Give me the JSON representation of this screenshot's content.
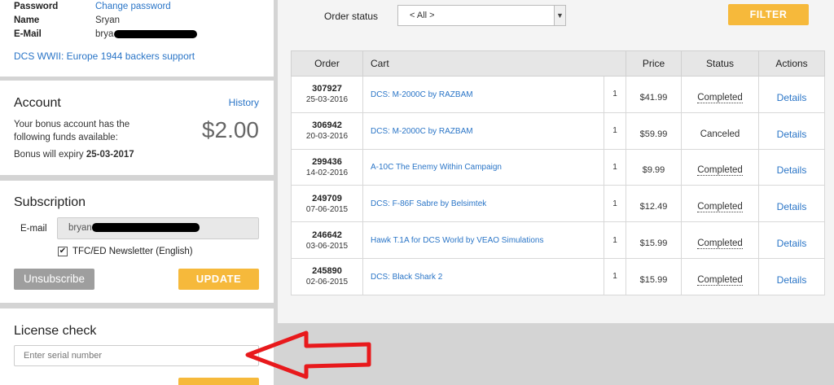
{
  "profile": {
    "password_label": "Password",
    "password_link": "Change password",
    "name_label": "Name",
    "name_value": "Sryan",
    "email_label": "E-Mail",
    "email_value": "brya",
    "backers_link": "DCS WWII: Europe 1944 backers support"
  },
  "account": {
    "title": "Account",
    "history_link": "History",
    "description": "Your bonus account has the following funds available:",
    "amount": "$2.00",
    "expiry_label": "Bonus will expiry",
    "expiry_date": "25-03-2017"
  },
  "subscription": {
    "title": "Subscription",
    "email_label": "E-mail",
    "email_value": "bryan",
    "newsletter_label": "TFC/ED Newsletter (English)",
    "newsletter_checked": true,
    "unsubscribe_label": "Unsubscribe",
    "update_label": "UPDATE"
  },
  "license": {
    "title": "License check",
    "serial_placeholder": "Enter serial number"
  },
  "filter": {
    "order_status_label": "Order status",
    "select_value": "< All >",
    "filter_button": "FILTER"
  },
  "table": {
    "headers": [
      "Order",
      "Cart",
      "Price",
      "Status",
      "Actions"
    ],
    "rows": [
      {
        "order": "307927",
        "date": "25-03-2016",
        "cart": "DCS: M-2000C by RAZBAM",
        "qty": "1",
        "price": "$41.99",
        "status": "Completed",
        "action": "Details"
      },
      {
        "order": "306942",
        "date": "20-03-2016",
        "cart": "DCS: M-2000C by RAZBAM",
        "qty": "1",
        "price": "$59.99",
        "status": "Canceled",
        "action": "Details"
      },
      {
        "order": "299436",
        "date": "14-02-2016",
        "cart": "A-10C The Enemy Within Campaign",
        "qty": "1",
        "price": "$9.99",
        "status": "Completed",
        "action": "Details"
      },
      {
        "order": "249709",
        "date": "07-06-2015",
        "cart": "DCS: F-86F Sabre by Belsimtek",
        "qty": "1",
        "price": "$12.49",
        "status": "Completed",
        "action": "Details"
      },
      {
        "order": "246642",
        "date": "03-06-2015",
        "cart": "Hawk T.1A for DCS World by VEAO Simulations",
        "qty": "1",
        "price": "$15.99",
        "status": "Completed",
        "action": "Details"
      },
      {
        "order": "245890",
        "date": "02-06-2015",
        "cart": "DCS: Black Shark 2",
        "qty": "1",
        "price": "$15.99",
        "status": "Completed",
        "action": "Details"
      }
    ]
  },
  "colors": {
    "accent_orange": "#f6b93b",
    "link_blue": "#2a75c7",
    "arrow_red": "#e8191c"
  }
}
